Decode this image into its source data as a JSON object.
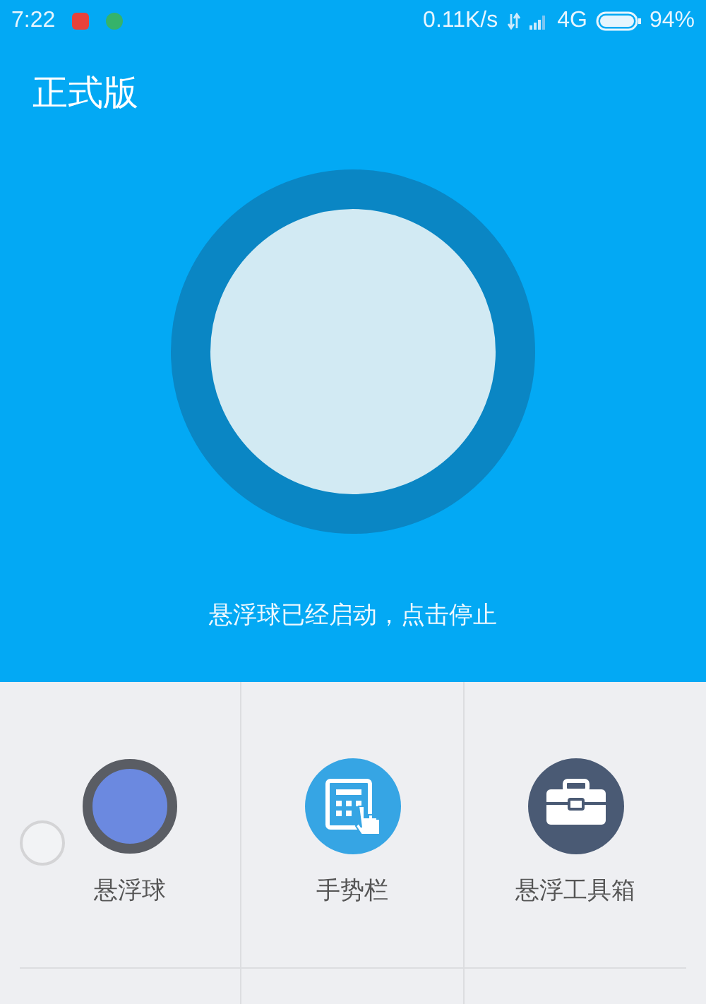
{
  "status_bar": {
    "time": "7:22",
    "speed": "0.11K/s",
    "network": "4G",
    "battery": "94%"
  },
  "header": {
    "title": "正式版",
    "status_text": "悬浮球已经启动，点击停止"
  },
  "tiles": [
    {
      "kind": "ball",
      "label": "悬浮球"
    },
    {
      "kind": "gesture",
      "label": "手势栏"
    },
    {
      "kind": "toolbox",
      "label": "悬浮工具箱"
    }
  ],
  "floating_ball": {
    "kind": "ball"
  }
}
